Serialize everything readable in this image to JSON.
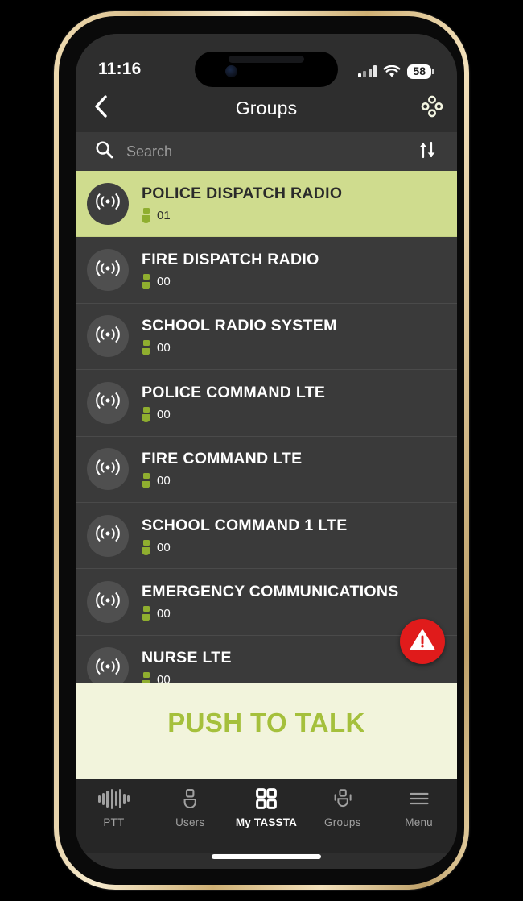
{
  "device": {
    "frame_color": "#d8bd8a"
  },
  "status_bar": {
    "time": "11:16",
    "battery_percent": "58",
    "signal_icon": "cellular-signal-icon",
    "wifi_icon": "wifi-icon"
  },
  "header": {
    "title": "Groups",
    "back_icon": "chevron-left-icon",
    "right_icon": "group-cluster-icon"
  },
  "search": {
    "placeholder": "Search",
    "value": "",
    "search_icon": "search-icon",
    "sort_icon": "sort-ascending-descending-icon"
  },
  "groups": [
    {
      "name": "POLICE DISPATCH RADIO",
      "members": "01",
      "selected": true,
      "avatar_icon": "radio-broadcast-icon"
    },
    {
      "name": "FIRE DISPATCH RADIO",
      "members": "00",
      "selected": false,
      "avatar_icon": "radio-broadcast-icon"
    },
    {
      "name": "SCHOOL RADIO SYSTEM",
      "members": "00",
      "selected": false,
      "avatar_icon": "radio-broadcast-icon"
    },
    {
      "name": "POLICE COMMAND LTE",
      "members": "00",
      "selected": false,
      "avatar_icon": "radio-broadcast-icon"
    },
    {
      "name": "FIRE COMMAND LTE",
      "members": "00",
      "selected": false,
      "avatar_icon": "radio-broadcast-icon"
    },
    {
      "name": "SCHOOL COMMAND 1 LTE",
      "members": "00",
      "selected": false,
      "avatar_icon": "radio-broadcast-icon"
    },
    {
      "name": "EMERGENCY COMMUNICATIONS",
      "members": "00",
      "selected": false,
      "avatar_icon": "radio-broadcast-icon"
    },
    {
      "name": "NURSE LTE",
      "members": "00",
      "selected": false,
      "avatar_icon": "radio-broadcast-icon"
    }
  ],
  "alert_button": {
    "icon": "warning-triangle-icon",
    "color": "#e01b1b"
  },
  "push_to_talk": {
    "label": "PUSH TO TALK",
    "text_color": "#a5c03c",
    "background": "#f2f4dc"
  },
  "tab_bar": {
    "items": [
      {
        "label": "PTT",
        "icon": "audio-waveform-icon",
        "active": false
      },
      {
        "label": "Users",
        "icon": "user-icon",
        "active": false
      },
      {
        "label": "My TASSTA",
        "icon": "four-squares-icon",
        "active": true
      },
      {
        "label": "Groups",
        "icon": "user-group-icon",
        "active": false
      },
      {
        "label": "Menu",
        "icon": "hamburger-menu-icon",
        "active": false
      }
    ]
  },
  "colors": {
    "accent_green": "#cfdc8e",
    "member_green": "#8fae2f",
    "alert_red": "#e01b1b",
    "surface": "#3a3a3a",
    "surface_dark": "#2e2e2e"
  }
}
